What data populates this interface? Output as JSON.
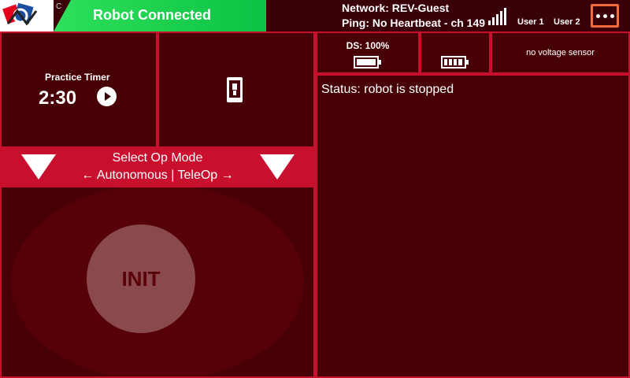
{
  "header": {
    "connection_status": "Robot Connected",
    "logo_mark": "C",
    "network": "Network: REV-Guest",
    "ping": "Ping: No Heartbeat - ch 149",
    "user1": "User 1",
    "user2": "User 2",
    "signal_icon": "signal-bars-icon",
    "menu_icon": "more-dots-icon",
    "colors": {
      "connected": "#0cc244",
      "bar": "#3a0007",
      "menu_border": "#f26a3a"
    }
  },
  "timer": {
    "label": "Practice Timer",
    "value": "2:30",
    "play_icon": "play-icon"
  },
  "phone_icon": "robot-phone-icon",
  "driver_station": {
    "label": "DS: 100%",
    "battery_icon": "ds-battery-icon"
  },
  "robot_battery_icon": "robot-battery-icon",
  "voltage": {
    "label": "no voltage sensor"
  },
  "status": {
    "text": "Status: robot is stopped"
  },
  "op_mode": {
    "title": "Select Op Mode",
    "subtitle": "← Autonomous | TeleOp →",
    "left_icon": "triangle-down-icon",
    "right_icon": "triangle-down-icon"
  },
  "init": {
    "label": "INIT"
  },
  "colors": {
    "accent": "#c8102e",
    "panel": "#470006",
    "init_button": "#8a4a4d"
  }
}
